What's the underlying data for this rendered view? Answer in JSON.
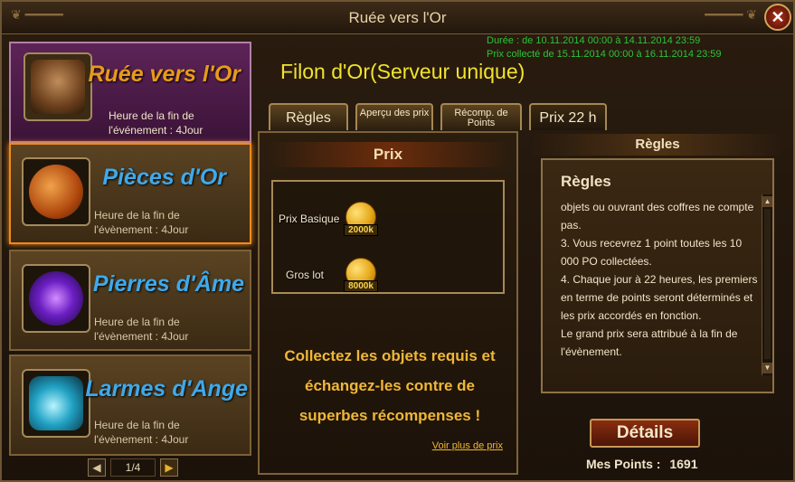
{
  "window": {
    "title": "Ruée vers l'Or",
    "close_glyph": "✕"
  },
  "sidebar": {
    "events": [
      {
        "name": "Ruée vers l'Or",
        "sub": "Heure de la fin de l'événement : 4Jour",
        "icon": "prospector-icon",
        "color": "#e89a1a"
      },
      {
        "name": "Pièces d'Or",
        "sub": "Heure de la fin de l'évènement : 4Jour",
        "icon": "gold-coin-icon",
        "color": "#3fa9ea"
      },
      {
        "name": "Pierres d'Âme",
        "sub": "Heure de la fin de l'évènement : 4Jour",
        "icon": "soul-stone-icon",
        "color": "#3fa9ea"
      },
      {
        "name": "Larmes d'Ange",
        "sub": "Heure de la fin de l'évènement : 4Jour",
        "icon": "angel-tear-potion-icon",
        "color": "#3fa9ea"
      }
    ],
    "pager": {
      "prev": "◀",
      "label": "1/4",
      "next": "▶"
    }
  },
  "header": {
    "duration": "Durée : de 10.11.2014 00:00 à 14.11.2014 23:59",
    "collected": "Prix collecté de 15.11.2014 00:00 à 16.11.2014 23:59",
    "title": "Filon d'Or(Serveur unique)"
  },
  "tabs": [
    {
      "label": "Règles"
    },
    {
      "label": "Aperçu des prix"
    },
    {
      "label": "Récomp. de Points"
    },
    {
      "label": "Prix 22 h"
    }
  ],
  "prize": {
    "header": "Prix",
    "rows": [
      {
        "label": "Prix Basique",
        "amount": "2000k"
      },
      {
        "label": "Gros lot",
        "amount": "8000k"
      }
    ],
    "collect_text": "Collectez les objets requis et échangez-les contre de superbes récompenses !",
    "more_link": "Voir plus de prix"
  },
  "rules": {
    "header": "Règles",
    "title": "Règles",
    "text": "objets ou ouvrant des coffres ne compte pas.\n3. Vous recevrez 1 point toutes les 10 000 PO collectées.\n4. Chaque jour à 22 heures, les premiers en terme de points seront déterminés et les prix accordés en fonction.\nLe grand prix sera attribué à la fin de l'évènement.",
    "scroll_up": "▲",
    "scroll_down": "▼"
  },
  "footer": {
    "details_label": "Détails",
    "points_label": "Mes Points :",
    "points_value": "1691"
  }
}
